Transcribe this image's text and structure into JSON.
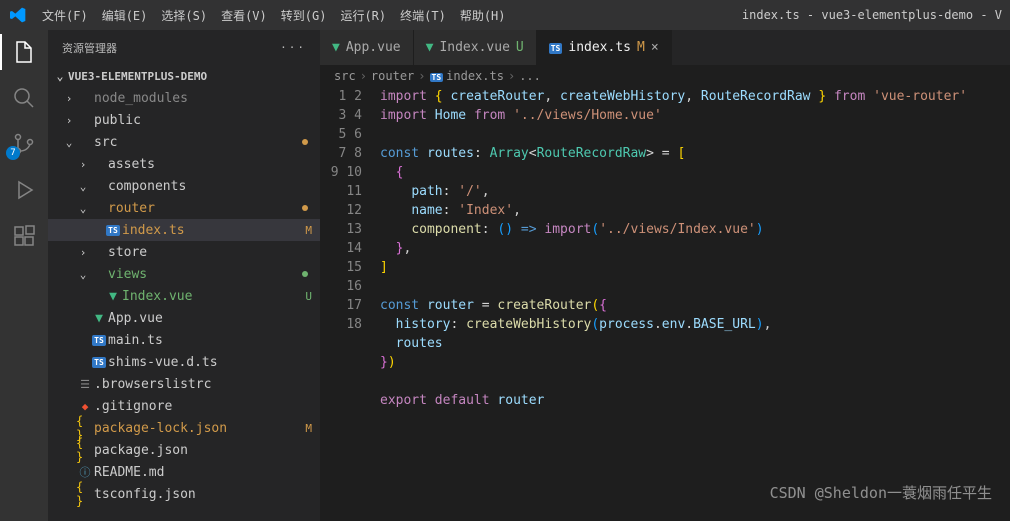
{
  "title": "index.ts - vue3-elementplus-demo - V",
  "menu": [
    "文件(F)",
    "编辑(E)",
    "选择(S)",
    "查看(V)",
    "转到(G)",
    "运行(R)",
    "终端(T)",
    "帮助(H)"
  ],
  "activity_badge": "7",
  "sidebar": {
    "title": "资源管理器",
    "project": "VUE3-ELEMENTPLUS-DEMO"
  },
  "tree": [
    {
      "pad": 14,
      "chev": "›",
      "icon": "",
      "label": "node_modules",
      "cls": "c-dim"
    },
    {
      "pad": 14,
      "chev": "›",
      "icon": "",
      "label": "public"
    },
    {
      "pad": 14,
      "chev": "⌄",
      "icon": "",
      "label": "src",
      "dot": "dot-orange"
    },
    {
      "pad": 28,
      "chev": "›",
      "icon": "",
      "label": "assets"
    },
    {
      "pad": 28,
      "chev": "⌄",
      "icon": "",
      "label": "components"
    },
    {
      "pad": 28,
      "chev": "⌄",
      "icon": "",
      "label": "router",
      "dot": "dot-orange",
      "cls": "c-mod"
    },
    {
      "pad": 42,
      "icon": "ts",
      "label": "index.ts",
      "status": "M",
      "cls": "c-mod",
      "selected": true
    },
    {
      "pad": 28,
      "chev": "›",
      "icon": "",
      "label": "store"
    },
    {
      "pad": 28,
      "chev": "⌄",
      "icon": "",
      "label": "views",
      "dot": "dot-green",
      "cls": "c-new"
    },
    {
      "pad": 42,
      "icon": "vue",
      "label": "Index.vue",
      "status": "U",
      "cls": "c-new"
    },
    {
      "pad": 28,
      "icon": "vue",
      "label": "App.vue"
    },
    {
      "pad": 28,
      "icon": "ts",
      "label": "main.ts"
    },
    {
      "pad": 28,
      "icon": "ts",
      "label": "shims-vue.d.ts"
    },
    {
      "pad": 14,
      "icon": "cfg",
      "label": ".browserslistrc"
    },
    {
      "pad": 14,
      "icon": "git",
      "label": ".gitignore"
    },
    {
      "pad": 14,
      "icon": "json",
      "label": "package-lock.json",
      "status": "M",
      "cls": "c-mod"
    },
    {
      "pad": 14,
      "icon": "json",
      "label": "package.json"
    },
    {
      "pad": 14,
      "icon": "md",
      "label": "README.md"
    },
    {
      "pad": 14,
      "icon": "json",
      "label": "tsconfig.json"
    }
  ],
  "tabs": [
    {
      "icon": "vue",
      "label": "App.vue",
      "cls": ""
    },
    {
      "icon": "vue",
      "label": "Index.vue",
      "status": "U",
      "statcls": "c-new"
    },
    {
      "icon": "ts",
      "label": "index.ts",
      "status": "M",
      "statcls": "c-mod",
      "active": true,
      "close": true
    }
  ],
  "breadcrumb": [
    "src",
    "router",
    "index.ts",
    "..."
  ],
  "lines": 18,
  "code": {
    "l1a": "import",
    "l1b": "createRouter",
    "l1c": "createWebHistory",
    "l1d": "RouteRecordRaw",
    "l1e": "from",
    "l1f": "'vue-router'",
    "l2a": "import",
    "l2b": "Home",
    "l2c": "from",
    "l2d": "'../views/Home.vue'",
    "l4a": "const",
    "l4b": "routes",
    "l4c": "Array",
    "l4d": "RouteRecordRaw",
    "l6a": "path",
    "l6b": "'/'",
    "l7a": "name",
    "l7b": "'Index'",
    "l8a": "component",
    "l8b": "import",
    "l8c": "'../views/Index.vue'",
    "l12a": "const",
    "l12b": "router",
    "l12c": "createRouter",
    "l13a": "history",
    "l13b": "createWebHistory",
    "l13c": "process",
    "l13d": "env",
    "l13e": "BASE_URL",
    "l14a": "routes",
    "l17a": "export",
    "l17b": "default",
    "l17c": "router"
  },
  "watermark": "CSDN @Sheldon一蓑烟雨任平生"
}
